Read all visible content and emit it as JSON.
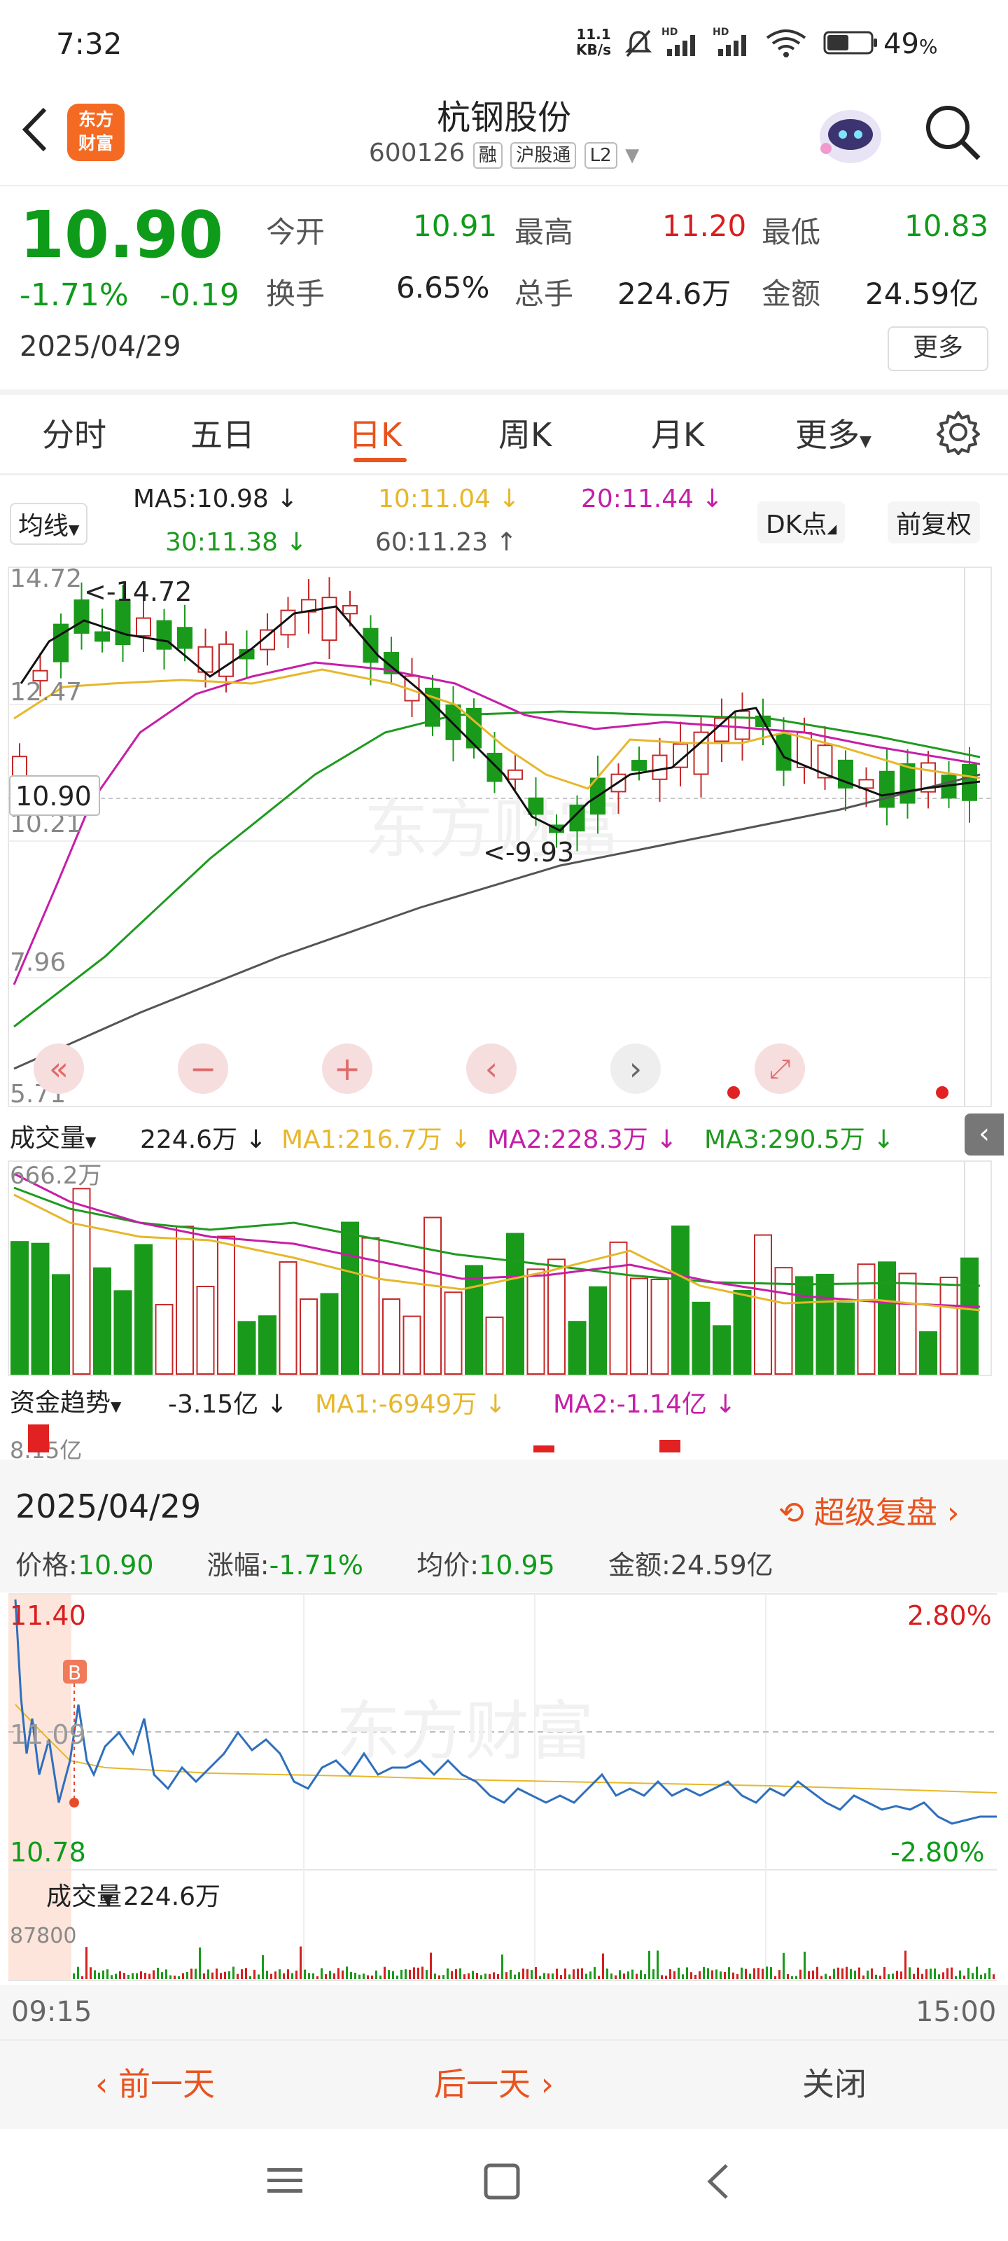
{
  "status_bar": {
    "time": "7:32",
    "speed": "11.1",
    "speed_unit": "KB/s",
    "battery": "49",
    "battery_unit": "%"
  },
  "header": {
    "app_logo": "东方财富",
    "title": "杭钢股份",
    "code": "600126",
    "tags": [
      "融",
      "沪股通",
      "L2"
    ]
  },
  "quote": {
    "price": "10.90",
    "change_pct": "-1.71%",
    "change": "-0.19",
    "date": "2025/04/29",
    "open_label": "今开",
    "open": "10.91",
    "high_label": "最高",
    "high": "11.20",
    "low_label": "最低",
    "low": "10.83",
    "turnover_label": "换手",
    "turnover": "6.65%",
    "volume_label": "总手",
    "volume": "224.6万",
    "amount_label": "金额",
    "amount": "24.59亿",
    "more": "更多"
  },
  "tabs": [
    "分时",
    "五日",
    "日K",
    "周K",
    "月K",
    "更多"
  ],
  "kline": {
    "indicator": "均线",
    "ma5": "MA5:10.98 ↓",
    "ma10": "10:11.04 ↓",
    "ma20": "20:11.44 ↓",
    "ma30": "30:11.38 ↓",
    "ma60": "60:11.23 ↑",
    "dk": "DK点",
    "adjust": "前复权",
    "axis": [
      "14.72",
      "12.47",
      "10.21",
      "7.96",
      "5.71"
    ],
    "current_price_tag": "10.90",
    "max_label": "<-14.72",
    "min_label": "<-9.93"
  },
  "volume_panel": {
    "label": "成交量",
    "value": "224.6万 ↓",
    "ma1": "MA1:216.7万 ↓",
    "ma2": "MA2:228.3万 ↓",
    "ma3": "MA3:290.5万 ↓",
    "axis_top": "666.2万"
  },
  "fund_panel": {
    "label": "资金趋势",
    "value": "-3.15亿 ↓",
    "ma1": "MA1:-6949万 ↓",
    "ma2": "MA2:-1.14亿 ↓",
    "axis_top": "8.15亿"
  },
  "review": {
    "date": "2025/04/29",
    "super_review": "超级复盘",
    "price_label": "价格:",
    "price": "10.90",
    "pct_label": "涨幅:",
    "pct": "-1.71%",
    "avg_label": "均价:",
    "avg": "10.95",
    "amount_label": "金额:",
    "amount": "24.59亿",
    "axis_high": "11.40",
    "axis_mid": "11.09",
    "axis_low": "10.78",
    "pct_high": "2.80%",
    "pct_low": "-2.80%",
    "b_marker": "B",
    "vol_label": "成交量",
    "vol_value": "224.6万",
    "vol_axis_top": "87800",
    "time_start": "09:15",
    "time_end": "15:00"
  },
  "bottom_actions": {
    "prev_day": "前一天",
    "next_day": "后一天",
    "close": "关闭"
  },
  "watermark": "东方财富"
}
